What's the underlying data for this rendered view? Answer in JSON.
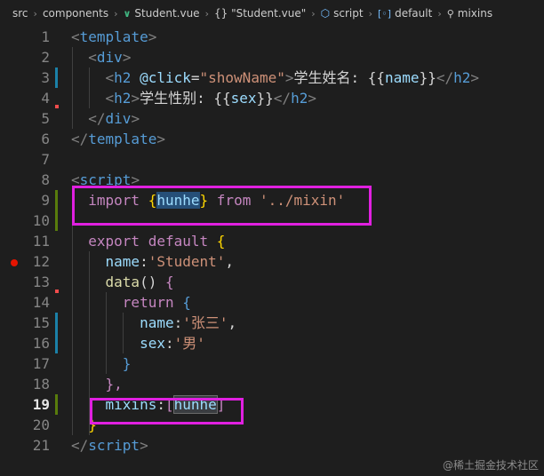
{
  "breadcrumb": {
    "items": [
      "src",
      "components",
      "Student.vue",
      "{} \"Student.vue\"",
      "script",
      "default",
      "mixins"
    ],
    "icons": [
      "",
      "",
      "vue-icon",
      "braces-icon",
      "cube-icon",
      "variable-icon",
      "wrench-icon"
    ]
  },
  "editor": {
    "active_line": 19,
    "lines": [
      {
        "n": "1"
      },
      {
        "n": "2"
      },
      {
        "n": "3"
      },
      {
        "n": "4"
      },
      {
        "n": "5"
      },
      {
        "n": "6"
      },
      {
        "n": "7"
      },
      {
        "n": "8"
      },
      {
        "n": "9"
      },
      {
        "n": "10"
      },
      {
        "n": "11"
      },
      {
        "n": "12"
      },
      {
        "n": "13"
      },
      {
        "n": "14"
      },
      {
        "n": "15"
      },
      {
        "n": "16"
      },
      {
        "n": "17"
      },
      {
        "n": "18"
      },
      {
        "n": "19"
      },
      {
        "n": "20"
      },
      {
        "n": "21"
      }
    ],
    "tokens": {
      "l1": [
        "<",
        "template",
        ">"
      ],
      "l2": [
        "<",
        "div",
        ">"
      ],
      "l3": [
        "<",
        "h2",
        " ",
        "@click",
        "=",
        "\"showName\"",
        ">",
        "学生姓名: ",
        "{{",
        "name",
        "}}",
        "</",
        "h2",
        ">"
      ],
      "l4": [
        "<",
        "h2",
        ">",
        "学生性别: ",
        "{{",
        "sex",
        "}}",
        "</",
        "h2",
        ">"
      ],
      "l5": [
        "</",
        "div",
        ">"
      ],
      "l6": [
        "</",
        "template",
        ">"
      ],
      "l8": [
        "<",
        "script",
        ">"
      ],
      "l9": [
        "import",
        " ",
        "{",
        "hunhe",
        "}",
        " ",
        "from",
        " ",
        "'../mixin'"
      ],
      "l11": [
        "export",
        " ",
        "default",
        " ",
        "{"
      ],
      "l12": [
        "name",
        ":",
        "'Student'",
        ","
      ],
      "l13": [
        "data",
        "()",
        " ",
        "{"
      ],
      "l14": [
        "return",
        " ",
        "{"
      ],
      "l15": [
        "name",
        ":",
        "'张三'",
        ","
      ],
      "l16": [
        "sex",
        ":",
        "'男'"
      ],
      "l17": [
        "}"
      ],
      "l18": [
        "},"
      ],
      "l19": [
        "mixins",
        ":",
        "[",
        "hunhe",
        "]"
      ],
      "l20": [
        "}"
      ],
      "l21": [
        "</",
        "script",
        ">"
      ]
    }
  },
  "watermark": "@稀土掘金技术社区"
}
